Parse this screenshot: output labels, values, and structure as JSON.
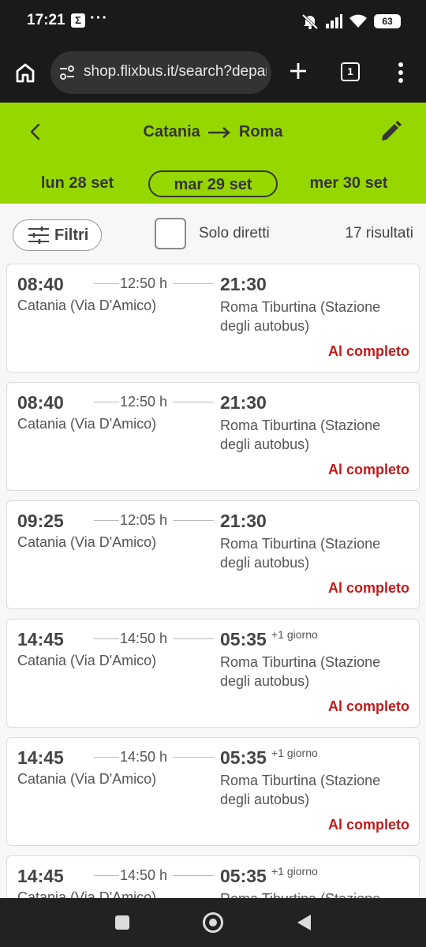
{
  "status_bar": {
    "time": "17:21",
    "notification_icon": "sigma",
    "more": "···",
    "battery": "63",
    "icons": [
      "mute-icon",
      "signal-icon",
      "wifi-icon",
      "battery-icon"
    ]
  },
  "browser": {
    "url": "shop.flixbus.it/search?departure",
    "tab_count": "1"
  },
  "header": {
    "origin": "Catania",
    "destination": "Roma",
    "brand_color": "#97d700",
    "dates": [
      {
        "label": "lun 28 set",
        "selected": false
      },
      {
        "label": "mar 29 set",
        "selected": true
      },
      {
        "label": "mer 30 set",
        "selected": false
      }
    ]
  },
  "toolbar": {
    "filter_label": "Filtri",
    "direct_label": "Solo diretti",
    "direct_checked": false,
    "results_label": "17 risultati"
  },
  "trips": [
    {
      "dep": "08:40",
      "duration": "12:50 h",
      "arr": "21:30",
      "next_day": "",
      "from": "Catania (Via D'Amico)",
      "to": "Roma Tiburtina (Stazione degli autobus)",
      "status": "Al completo"
    },
    {
      "dep": "08:40",
      "duration": "12:50 h",
      "arr": "21:30",
      "next_day": "",
      "from": "Catania (Via D'Amico)",
      "to": "Roma Tiburtina (Stazione degli autobus)",
      "status": "Al completo"
    },
    {
      "dep": "09:25",
      "duration": "12:05 h",
      "arr": "21:30",
      "next_day": "",
      "from": "Catania (Via D'Amico)",
      "to": "Roma Tiburtina (Stazione degli autobus)",
      "status": "Al completo"
    },
    {
      "dep": "14:45",
      "duration": "14:50 h",
      "arr": "05:35",
      "next_day": "+1 giorno",
      "from": "Catania (Via D'Amico)",
      "to": "Roma Tiburtina (Stazione degli autobus)",
      "status": "Al completo"
    },
    {
      "dep": "14:45",
      "duration": "14:50 h",
      "arr": "05:35",
      "next_day": "+1 giorno",
      "from": "Catania (Via D'Amico)",
      "to": "Roma Tiburtina (Stazione degli autobus)",
      "status": "Al completo"
    },
    {
      "dep": "14:45",
      "duration": "14:50 h",
      "arr": "05:35",
      "next_day": "+1 giorno",
      "from": "Catania (Via D'Amico)",
      "to": "Roma Tiburtina (Stazione",
      "status": ""
    }
  ]
}
